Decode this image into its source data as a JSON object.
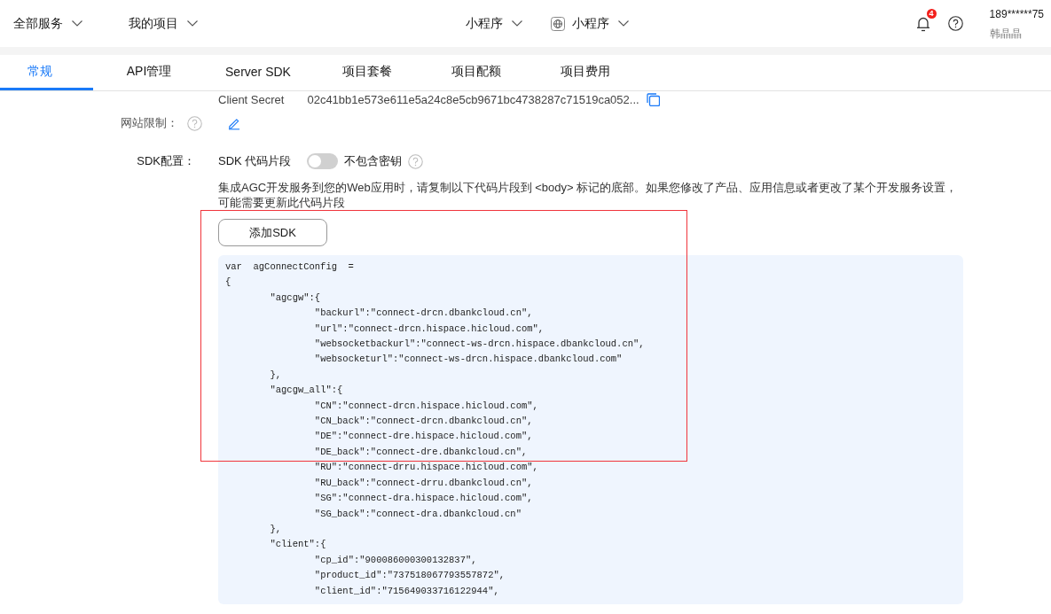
{
  "header": {
    "left_menus": [
      {
        "kind": "plain",
        "label": "全部服务"
      },
      {
        "kind": "plain",
        "label": "我的项目"
      }
    ],
    "center_menus": [
      {
        "kind": "plain",
        "label": "小程序"
      },
      {
        "kind": "app",
        "label": "小程序"
      }
    ],
    "notifications": {
      "badge": "4"
    },
    "user": {
      "account": "189******75",
      "name": "韩晶晶"
    }
  },
  "tabs": [
    {
      "label": "常规",
      "selected": true
    },
    {
      "label": "API管理",
      "selected": false
    },
    {
      "label": "Server SDK",
      "selected": false
    },
    {
      "label": "项目套餐",
      "selected": false
    },
    {
      "label": "项目配额",
      "selected": false
    },
    {
      "label": "项目费用",
      "selected": false
    }
  ],
  "settings": {
    "client_secret": {
      "label": "Client Secret",
      "value": "02c41bb1e573e611e5a24c8e5cb9671bc4738287c71519ca052..."
    },
    "site_restriction": {
      "label": "网站限制："
    },
    "sdk_config": {
      "label": "SDK配置：",
      "snippet_label": "SDK 代码片段",
      "include_key_toggle": {
        "on": false,
        "label": "不包含密钥"
      },
      "description": "集成AGC开发服务到您的Web应用时，请复制以下代码片段到 <body> 标记的底部。如果您修改了产品、应用信息或者更改了某个开发服务设置，可能需要更新此代码片段",
      "add_button": "添加SDK",
      "highlighted": true,
      "code": "var  agConnectConfig  =\n{\n\t\"agcgw\":{\n\t\t\"backurl\":\"connect-drcn.dbankcloud.cn\",\n\t\t\"url\":\"connect-drcn.hispace.hicloud.com\",\n\t\t\"websocketbackurl\":\"connect-ws-drcn.hispace.dbankcloud.cn\",\n\t\t\"websocketurl\":\"connect-ws-drcn.hispace.dbankcloud.com\"\n\t},\n\t\"agcgw_all\":{\n\t\t\"CN\":\"connect-drcn.hispace.hicloud.com\",\n\t\t\"CN_back\":\"connect-drcn.dbankcloud.cn\",\n\t\t\"DE\":\"connect-dre.hispace.hicloud.com\",\n\t\t\"DE_back\":\"connect-dre.dbankcloud.cn\",\n\t\t\"RU\":\"connect-drru.hispace.hicloud.com\",\n\t\t\"RU_back\":\"connect-drru.dbankcloud.cn\",\n\t\t\"SG\":\"connect-dra.hispace.hicloud.com\",\n\t\t\"SG_back\":\"connect-dra.dbankcloud.cn\"\n\t},\n\t\"client\":{\n\t\t\"cp_id\":\"900086000300132837\",\n\t\t\"product_id\":\"737518067793557872\",\n\t\t\"client_id\":\"715649033716122944\","
    }
  }
}
